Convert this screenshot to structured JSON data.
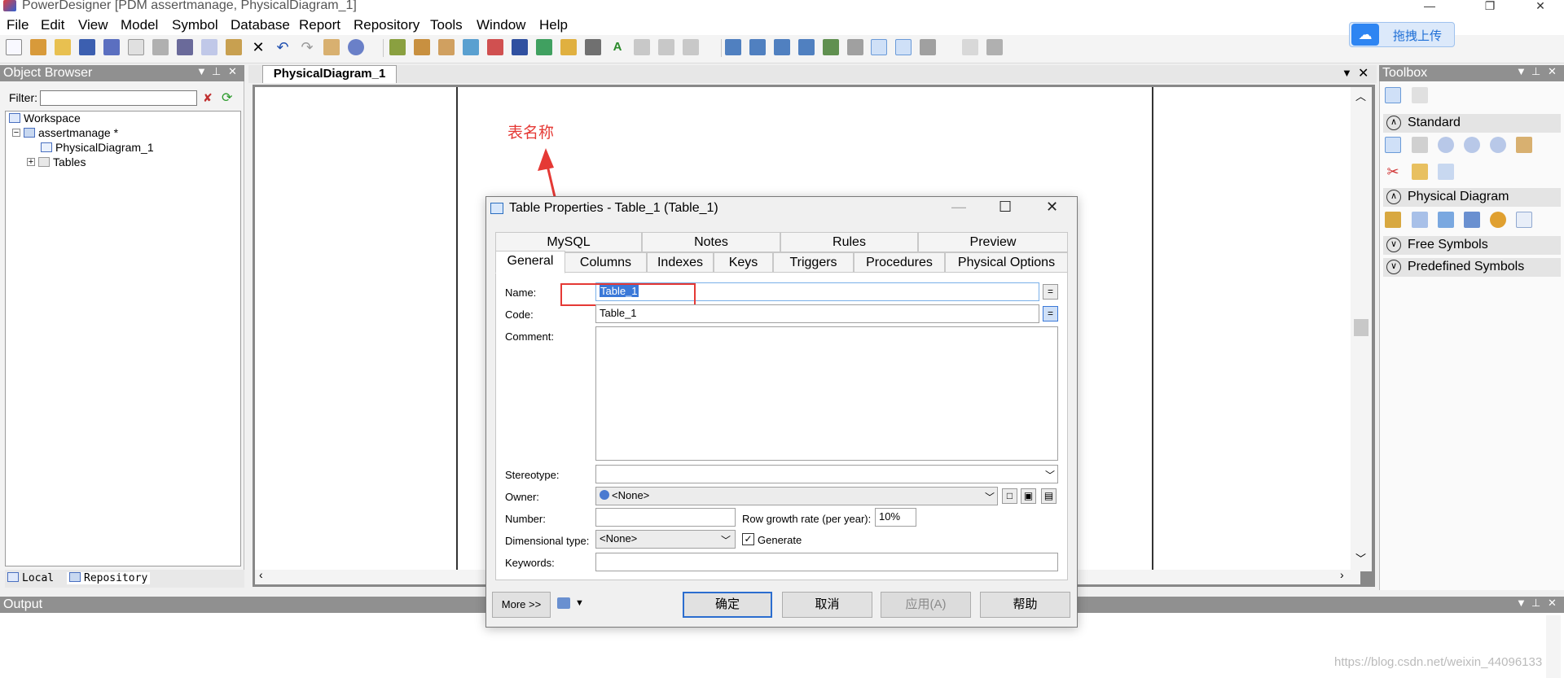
{
  "window": {
    "title": "PowerDesigner [PDM assertmanage, PhysicalDiagram_1]",
    "controls": [
      "—",
      "❐",
      "✕"
    ]
  },
  "menu": [
    "File",
    "Edit",
    "View",
    "Model",
    "Symbol",
    "Database",
    "Report",
    "Repository",
    "Tools",
    "Window",
    "Help"
  ],
  "upload": {
    "label": "拖拽上传"
  },
  "object_browser": {
    "title": "Object Browser",
    "filter_label": "Filter:",
    "filter_value": "",
    "tree": [
      {
        "label": "Workspace",
        "depth": 0
      },
      {
        "label": "assertmanage *",
        "depth": 1
      },
      {
        "label": "PhysicalDiagram_1",
        "depth": 2
      },
      {
        "label": "Tables",
        "depth": 2
      }
    ],
    "tabs": [
      "Local",
      "Repository"
    ]
  },
  "diagram": {
    "tab": "PhysicalDiagram_1"
  },
  "toolbox": {
    "title": "Toolbox",
    "sections": [
      "Standard",
      "Physical Diagram",
      "Free Symbols",
      "Predefined Symbols"
    ]
  },
  "output": {
    "title": "Output"
  },
  "annotation": {
    "text": "表名称"
  },
  "dialog": {
    "title": "Table Properties - Table_1 (Table_1)",
    "tabs_row1": [
      "MySQL",
      "Notes",
      "Rules",
      "Preview"
    ],
    "tabs_row2": [
      "General",
      "Columns",
      "Indexes",
      "Keys",
      "Triggers",
      "Procedures",
      "Physical Options"
    ],
    "active_tab": "General",
    "fields": {
      "name_label": "Name:",
      "name_value": "Table_1",
      "code_label": "Code:",
      "code_value": "Table_1",
      "comment_label": "Comment:",
      "comment_value": "",
      "stereotype_label": "Stereotype:",
      "stereotype_value": "",
      "owner_label": "Owner:",
      "owner_value": "<None>",
      "number_label": "Number:",
      "number_value": "",
      "growth_label": "Row growth rate (per year):",
      "growth_value": "10%",
      "dimtype_label": "Dimensional type:",
      "dimtype_value": "<None>",
      "generate_label": "Generate",
      "keywords_label": "Keywords:",
      "keywords_value": ""
    },
    "buttons": {
      "more": "More >>",
      "ok": "确定",
      "cancel": "取消",
      "apply": "应用(A)",
      "help": "帮助"
    }
  },
  "watermark": "https://blog.csdn.net/weixin_44096133",
  "colors": {
    "accent": "#2b6dcf",
    "annotation": "#e53935",
    "panel_header": "#909090"
  }
}
